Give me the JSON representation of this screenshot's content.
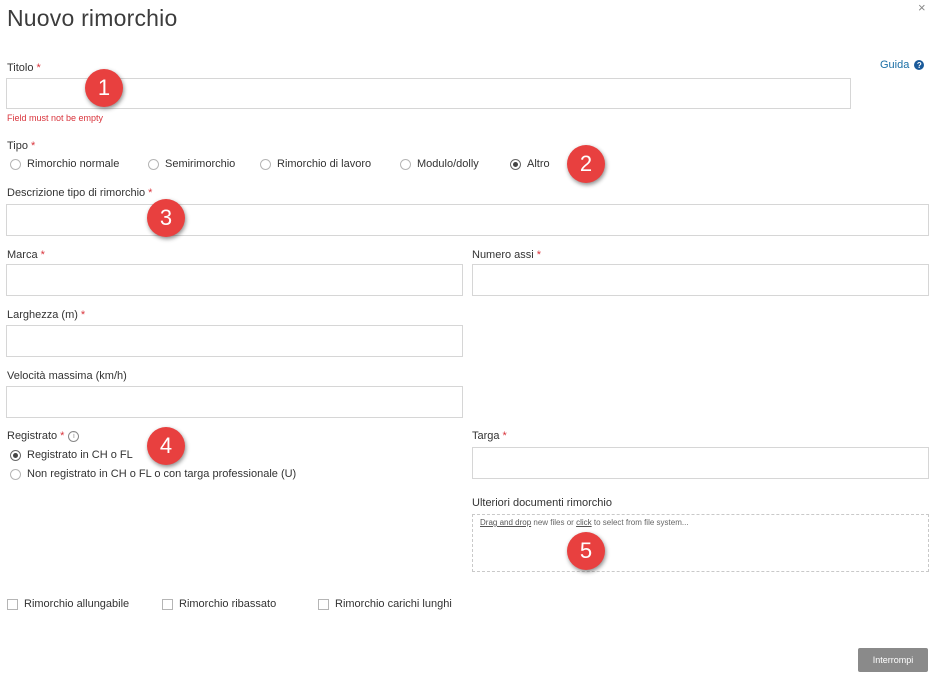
{
  "header": {
    "title": "Nuovo rimorchio",
    "close_icon": "×",
    "help_label": "Guida",
    "help_icon": "?"
  },
  "fields": {
    "titolo": {
      "label": "Titolo",
      "value": "",
      "error": "Field must not be empty"
    },
    "tipo": {
      "label": "Tipo",
      "options": [
        "Rimorchio normale",
        "Semirimorchio",
        "Rimorchio di lavoro",
        "Modulo/dolly",
        "Altro"
      ],
      "selected": "Altro"
    },
    "descrizione_tipo": {
      "label": "Descrizione tipo di rimorchio",
      "value": ""
    },
    "marca": {
      "label": "Marca",
      "value": ""
    },
    "numero_assi": {
      "label": "Numero assi",
      "value": ""
    },
    "larghezza": {
      "label": "Larghezza (m)",
      "value": ""
    },
    "velocita": {
      "label": "Velocità massima (km/h)",
      "value": ""
    },
    "registrato": {
      "label": "Registrato",
      "info_icon": "i",
      "options": [
        "Registrato in CH o FL",
        "Non registrato in CH o FL o con targa professionale (U)"
      ],
      "selected": "Registrato in CH o FL"
    },
    "targa": {
      "label": "Targa",
      "value": ""
    },
    "documenti": {
      "label": "Ulteriori documenti rimorchio",
      "drag_link": "Drag and drop",
      "text_mid": " new files or ",
      "click_link": "click",
      "text_end": " to select from file system..."
    }
  },
  "required_mark": "*",
  "checkboxes": [
    "Rimorchio allungabile",
    "Rimorchio ribassato",
    "Rimorchio carichi lunghi"
  ],
  "buttons": {
    "cancel": "Interrompi"
  },
  "annotations": [
    "1",
    "2",
    "3",
    "4",
    "5"
  ],
  "colors": {
    "required": "#d9343c",
    "badge": "#e8403f",
    "link": "#1a6fa6",
    "button": "#8a8a8a"
  }
}
